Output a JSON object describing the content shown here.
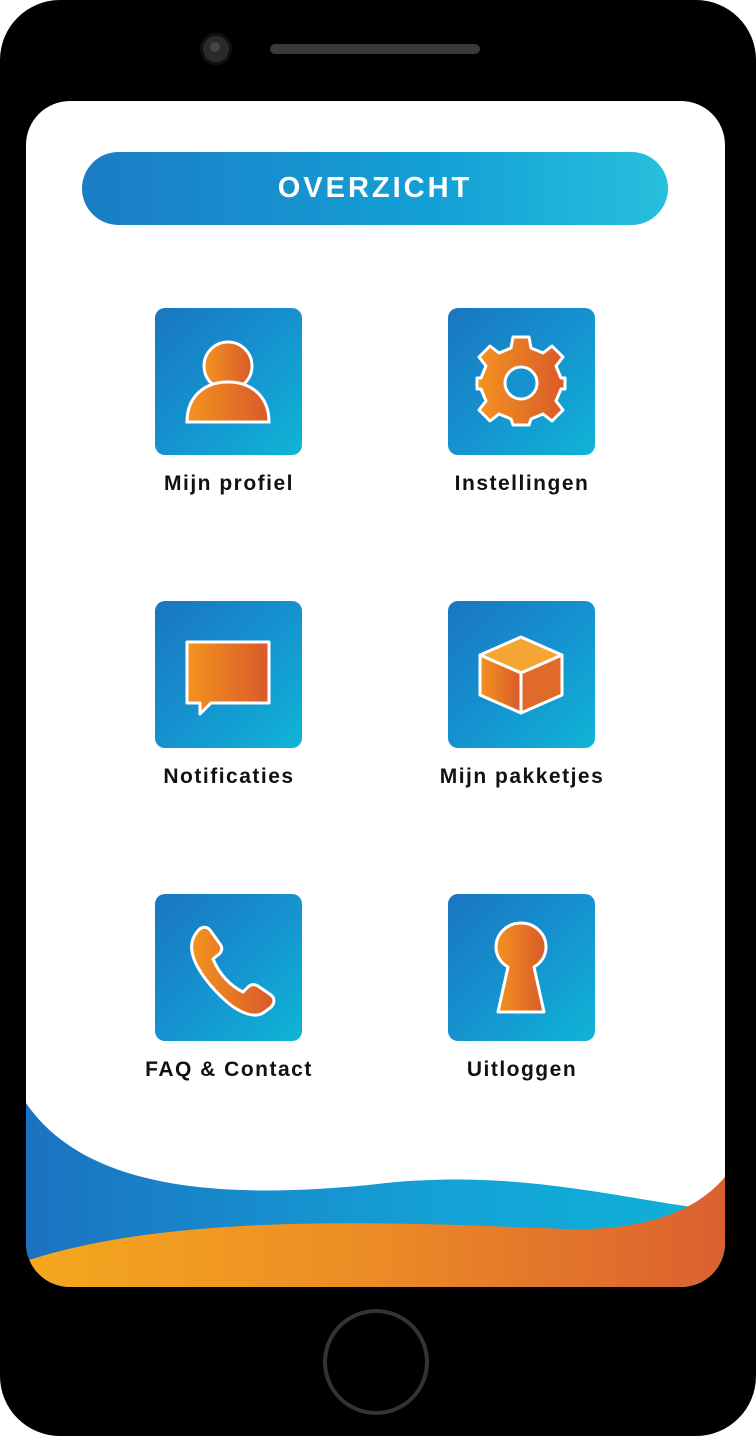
{
  "header": {
    "title": "OVERZICHT"
  },
  "menu": [
    {
      "label": "Mijn profiel",
      "icon": "user-icon"
    },
    {
      "label": "Instellingen",
      "icon": "gear-icon"
    },
    {
      "label": "Notificaties",
      "icon": "chat-bubble-icon"
    },
    {
      "label": "Mijn pakketjes",
      "icon": "package-icon"
    },
    {
      "label": "FAQ & Contact",
      "icon": "phone-icon"
    },
    {
      "label": "Uitloggen",
      "icon": "keyhole-icon"
    }
  ],
  "colors": {
    "tile_blue": "#1592cf",
    "accent_orange": "#e36f22",
    "wave_blue": "#1b7dc4",
    "wave_orange": "#f29a1f"
  }
}
